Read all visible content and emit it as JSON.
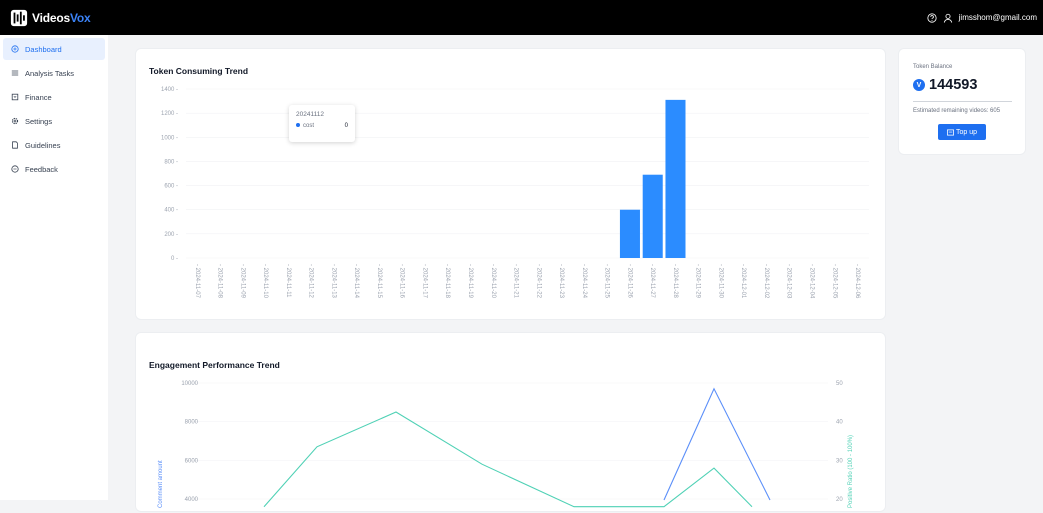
{
  "app": {
    "brand_prefix": "Videos",
    "brand_suffix": "Vox",
    "user_email": "jimsshom@gmail.com"
  },
  "sidebar": {
    "items": [
      {
        "label": "Dashboard",
        "icon": "dashboard-icon",
        "active": true
      },
      {
        "label": "Analysis Tasks",
        "icon": "list-icon",
        "active": false
      },
      {
        "label": "Finance",
        "icon": "finance-icon",
        "active": false
      },
      {
        "label": "Settings",
        "icon": "settings-icon",
        "active": false
      },
      {
        "label": "Guidelines",
        "icon": "document-icon",
        "active": false
      },
      {
        "label": "Feedback",
        "icon": "feedback-icon",
        "active": false
      }
    ]
  },
  "balance": {
    "label": "Token Balance",
    "value": "144593",
    "remaining": "Estimated remaining videos: 605",
    "topup_label": "Top up"
  },
  "token_chart": {
    "title": "Token Consuming Trend",
    "tooltip": {
      "date": "20241112",
      "series": "cost",
      "value": "0"
    }
  },
  "engagement_chart": {
    "title": "Engagement Performance Trend",
    "left_axis_label": "Comment amount",
    "right_axis_label": "Positive Ratio (100 - 100%)"
  },
  "colors": {
    "accent": "#1e6ff0",
    "bar": "#2b8cff",
    "line_blue": "#5b8ff9",
    "line_green": "#4fd1b5"
  },
  "chart_data": [
    {
      "type": "bar",
      "title": "Token Consuming Trend",
      "categories": [
        "2024-11-07",
        "2024-11-08",
        "2024-11-09",
        "2024-11-10",
        "2024-11-11",
        "2024-11-12",
        "2024-11-13",
        "2024-11-14",
        "2024-11-15",
        "2024-11-16",
        "2024-11-17",
        "2024-11-18",
        "2024-11-19",
        "2024-11-20",
        "2024-11-21",
        "2024-11-22",
        "2024-11-23",
        "2024-11-24",
        "2024-11-25",
        "2024-11-26",
        "2024-11-27",
        "2024-11-28",
        "2024-11-29",
        "2024-11-30",
        "2024-12-01",
        "2024-12-02",
        "2024-12-03",
        "2024-12-04",
        "2024-12-05",
        "2024-12-06"
      ],
      "series": [
        {
          "name": "cost",
          "values": [
            0,
            0,
            0,
            0,
            0,
            0,
            0,
            0,
            0,
            0,
            0,
            0,
            0,
            0,
            0,
            0,
            0,
            0,
            0,
            400,
            690,
            1310,
            0,
            0,
            0,
            0,
            0,
            0,
            0,
            0
          ]
        }
      ],
      "yticks": [
        0,
        200,
        400,
        600,
        800,
        1000,
        1200,
        1400
      ],
      "ylim": [
        0,
        1400
      ]
    },
    {
      "type": "line",
      "title": "Engagement Performance Trend",
      "yticks_left": [
        4000,
        6000,
        8000,
        10000
      ],
      "yticks_right": [
        20,
        30,
        40,
        50
      ],
      "series": [
        {
          "axis": "left",
          "color": "#5b8ff9",
          "x": [
            0,
            1,
            2
          ],
          "values": [
            3950,
            9700,
            3950
          ]
        },
        {
          "axis": "right",
          "color": "#4fd1b5",
          "x": [
            0,
            1,
            2,
            3,
            4,
            5,
            6,
            7
          ],
          "values": [
            18,
            33.5,
            42.5,
            29,
            18,
            18,
            28,
            18
          ]
        }
      ]
    }
  ]
}
